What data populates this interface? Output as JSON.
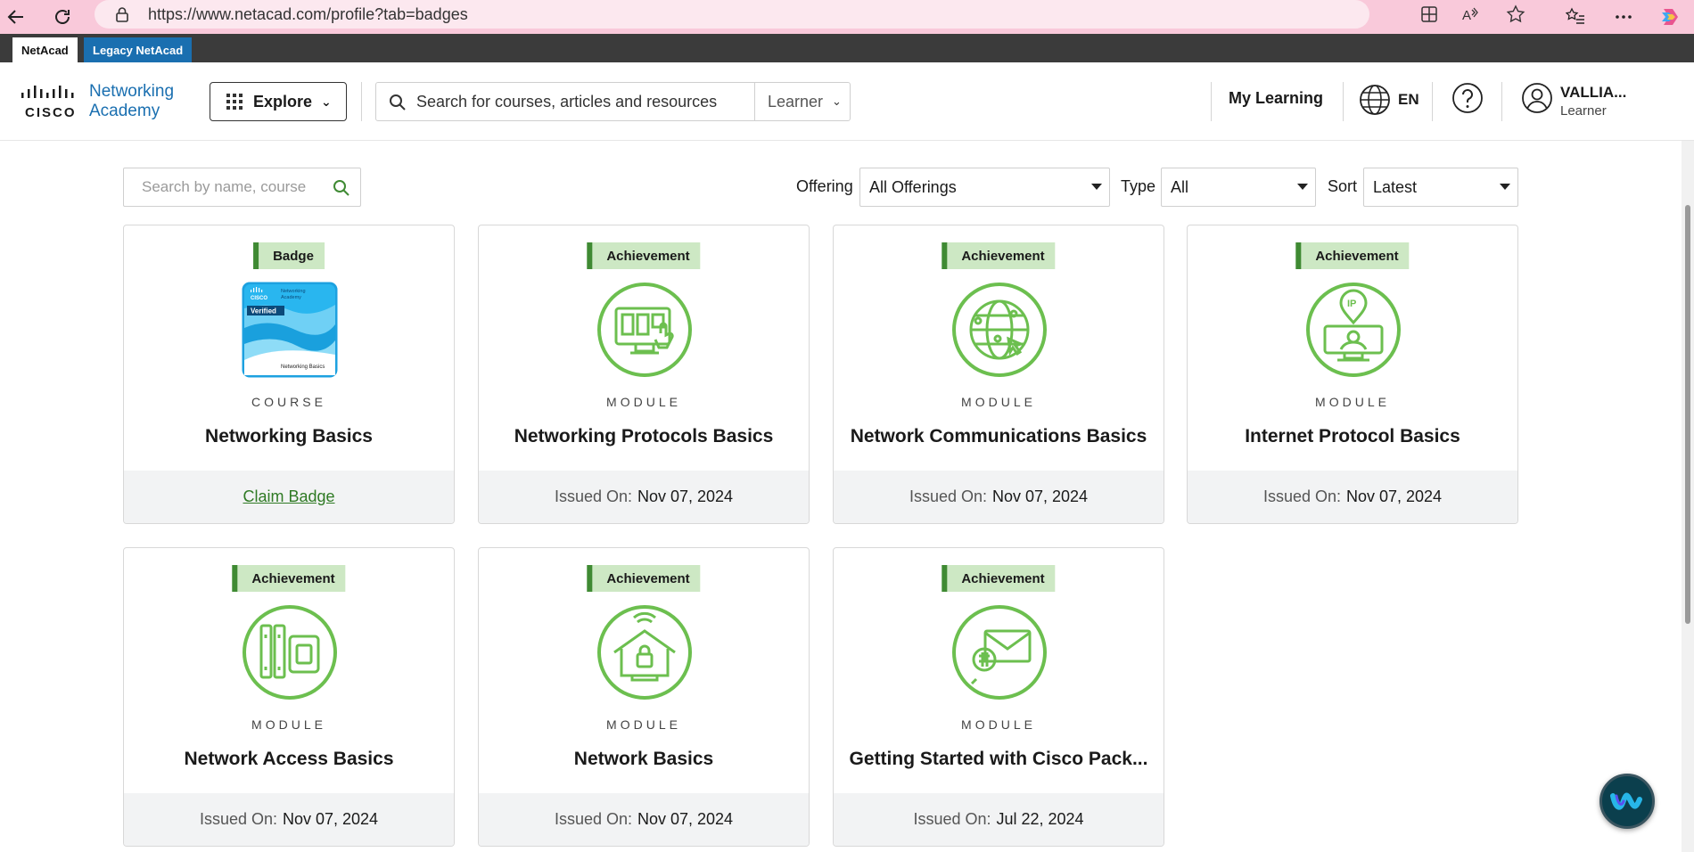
{
  "browser": {
    "url": "https://www.netacad.com/profile?tab=badges"
  },
  "env_tabs": {
    "netacad": "NetAcad",
    "legacy": "Legacy NetAcad"
  },
  "header": {
    "logo_brand": "CISCO",
    "logo_product_line1": "Networking",
    "logo_product_line2": "Academy",
    "explore_label": "Explore",
    "search_placeholder": "Search for courses, articles and resources",
    "role_label": "Learner",
    "my_learning": "My Learning",
    "language": "EN",
    "user_name": "VALLIA...",
    "user_role": "Learner"
  },
  "filters": {
    "search_placeholder": "Search by name, course",
    "offering_label": "Offering",
    "offering_value": "All Offerings",
    "type_label": "Type",
    "type_value": "All",
    "sort_label": "Sort",
    "sort_value": "Latest"
  },
  "cards": [
    {
      "tag": "Badge",
      "kind": "COURSE",
      "title": "Networking Basics",
      "action": "Claim Badge",
      "icon": "course-badge-image",
      "badge_text_verified": "Verified",
      "badge_text_name": "Networking Basics"
    },
    {
      "tag": "Achievement",
      "kind": "MODULE",
      "title": "Networking Protocols Basics",
      "issued_label": "Issued On:",
      "issued_date": "Nov 07, 2024",
      "icon": "monitor-touch-icon"
    },
    {
      "tag": "Achievement",
      "kind": "MODULE",
      "title": "Network Communications Basics",
      "issued_label": "Issued On:",
      "issued_date": "Nov 07, 2024",
      "icon": "globe-network-icon"
    },
    {
      "tag": "Achievement",
      "kind": "MODULE",
      "title": "Internet Protocol Basics",
      "issued_label": "Issued On:",
      "issued_date": "Nov 07, 2024",
      "icon": "ip-monitor-icon"
    },
    {
      "tag": "Achievement",
      "kind": "MODULE",
      "title": "Network Access Basics",
      "issued_label": "Issued On:",
      "issued_date": "Nov 07, 2024",
      "icon": "server-rack-icon"
    },
    {
      "tag": "Achievement",
      "kind": "MODULE",
      "title": "Network Basics",
      "issued_label": "Issued On:",
      "issued_date": "Nov 07, 2024",
      "icon": "smart-home-lock-icon"
    },
    {
      "tag": "Achievement",
      "kind": "MODULE",
      "title": "Getting Started with Cisco Pack...",
      "issued_label": "Issued On:",
      "issued_date": "Jul 22, 2024",
      "icon": "envelope-search-icon"
    }
  ],
  "colors": {
    "accent_green": "#3f8a33",
    "tag_bg": "#cde8c4",
    "emblem_green": "#6cbf4f",
    "brand_blue": "#1a6fb0",
    "browser_bar": "#f9c9da"
  }
}
